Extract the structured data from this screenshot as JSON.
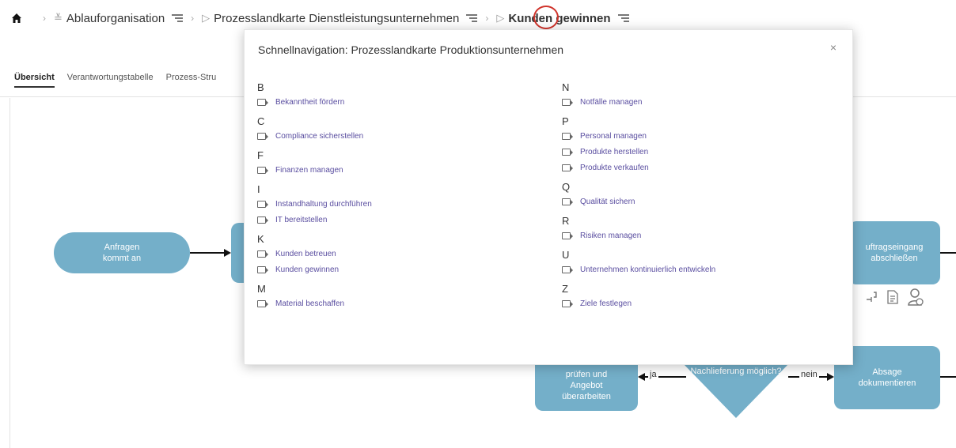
{
  "breadcrumb": {
    "crumbs": [
      {
        "label": "Ablauforganisation"
      },
      {
        "label": "Prozesslandkarte Dienstleistungsunternehmen"
      },
      {
        "label": "Kunden gewinnen"
      }
    ]
  },
  "tabs": [
    "Übersicht",
    "Verantwortungstabelle",
    "Prozess-Stru"
  ],
  "diagram": {
    "nodes": {
      "start": "Anfragen kommt an",
      "auftrag": "uftragseingang abschließen",
      "pruefen": "prüfen und Angebot überarbeiten",
      "decision": "Nachlieferung möglich?",
      "absage": "Absage dokumentieren"
    },
    "edge_labels": {
      "ja": "ja",
      "nein": "nein"
    }
  },
  "quicknav": {
    "title": "Schnellnavigation: Prozesslandkarte Produktionsunternehmen",
    "close": "×",
    "left_groups": [
      {
        "letter": "B",
        "items": [
          "Bekanntheit fördern"
        ]
      },
      {
        "letter": "C",
        "items": [
          "Compliance sicherstellen"
        ]
      },
      {
        "letter": "F",
        "items": [
          "Finanzen managen"
        ]
      },
      {
        "letter": "I",
        "items": [
          "Instandhaltung durchführen",
          "IT bereitstellen"
        ]
      },
      {
        "letter": "K",
        "items": [
          "Kunden betreuen",
          "Kunden gewinnen"
        ]
      },
      {
        "letter": "M",
        "items": [
          "Material beschaffen"
        ]
      }
    ],
    "right_groups": [
      {
        "letter": "N",
        "items": [
          "Notfälle managen"
        ]
      },
      {
        "letter": "P",
        "items": [
          "Personal managen",
          "Produkte herstellen",
          "Produkte verkaufen"
        ]
      },
      {
        "letter": "Q",
        "items": [
          "Qualität sichern"
        ]
      },
      {
        "letter": "R",
        "items": [
          "Risiken managen"
        ]
      },
      {
        "letter": "U",
        "items": [
          "Unternehmen kontinuierlich entwickeln"
        ]
      },
      {
        "letter": "Z",
        "items": [
          "Ziele festlegen"
        ]
      }
    ]
  },
  "colors": {
    "node": "#74afc9",
    "link": "#5a4ea0",
    "highlight": "#d0342c"
  }
}
